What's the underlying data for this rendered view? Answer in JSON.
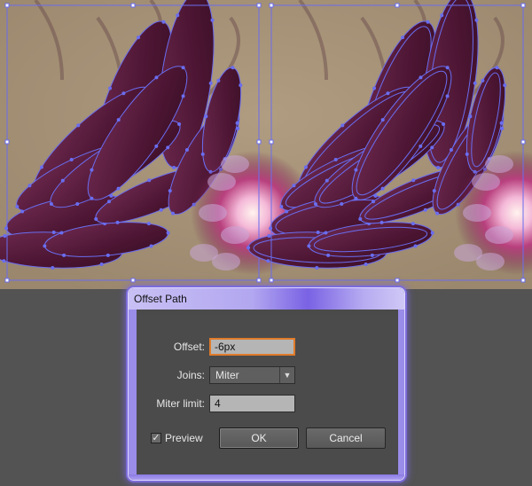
{
  "dialog": {
    "title": "Offset Path",
    "offset_label": "Offset:",
    "offset_value": "-6px",
    "joins_label": "Joins:",
    "joins_value": "Miter",
    "miter_label": "Miter limit:",
    "miter_value": "4",
    "preview_label": "Preview",
    "preview_checked": true,
    "ok_label": "OK",
    "cancel_label": "Cancel"
  },
  "icons": {
    "checkmark": "check-icon",
    "dropdown": "triangle-down-icon"
  },
  "colors": {
    "canvas_background": "#a8957a",
    "petal": "#5a1e3f",
    "path_selection": "#6a6df0",
    "dialog_accent": "#7a62e4",
    "focus_border": "#e07b2a"
  }
}
